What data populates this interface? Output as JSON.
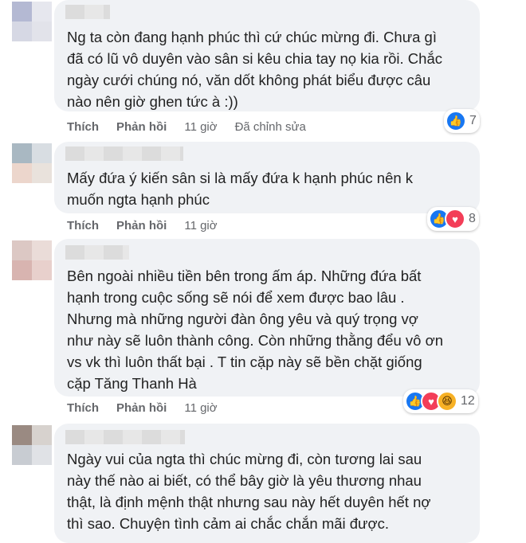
{
  "comments": [
    {
      "lines": [
        "Ng ta còn đang hạnh phúc thì cứ chúc mừng đi. Chưa gì",
        "đã có lũ vô duyên vào sân si kêu chia tay nọ kia rồi. Chắc",
        "ngày cưới chúng nó, văn dốt không phát biểu được câu",
        "nào nên giờ ghen tức à :))"
      ],
      "like_label": "Thích",
      "reply_label": "Phản hồi",
      "time": "11 giờ",
      "edited": "Đã chỉnh sửa",
      "reactions": [
        "like"
      ],
      "reaction_count": "7",
      "avatar_colors": [
        "#b4b9d3",
        "#e6e7ee",
        "#d6d8e4",
        "#e2e3ea"
      ]
    },
    {
      "lines": [
        "Mấy đứa ý kiến sân si là mấy đứa k hạnh phúc nên k",
        "muốn ngta hạnh phúc"
      ],
      "like_label": "Thích",
      "reply_label": "Phản hồi",
      "time": "11 giờ",
      "reactions": [
        "like",
        "love"
      ],
      "reaction_count": "8",
      "avatar_colors": [
        "#a9b8c2",
        "#d8dde2",
        "#ecd6cc",
        "#e9e2dc"
      ]
    },
    {
      "lines": [
        "Bên ngoài nhiều tiền bên trong ấm áp. Những đứa bất",
        "hạnh trong cuộc sống sẽ nói để xem được bao lâu .",
        "Nhưng mà những người đàn ông yêu và quý trọng vợ",
        "như này sẽ luôn thành công. Còn những thằng đểu vô ơn",
        "vs vk thì luôn thất bại . T tin cặp này sẽ bền chặt giống",
        "cặp Tăng Thanh Hà"
      ],
      "like_label": "Thích",
      "reply_label": "Phản hồi",
      "time": "11 giờ",
      "reactions": [
        "like",
        "love",
        "haha"
      ],
      "reaction_count": "12",
      "avatar_colors": [
        "#dcc8c4",
        "#eadcd8",
        "#d8b4b0",
        "#e8d0cc"
      ]
    },
    {
      "lines": [
        "Ngày vui của ngta thì chúc mừng đi, còn tương lai sau",
        "này thế nào ai biết, có thể bây giờ là yêu thương nhau",
        "thật, là định mệnh thật nhưng sau này hết duyên hết nợ",
        "thì sao. Chuyện tình cảm ai chắc chắn mãi được."
      ],
      "avatar_colors": [
        "#9a8a82",
        "#d7d2ce",
        "#c8ccd2",
        "#e0e2e6"
      ]
    }
  ]
}
